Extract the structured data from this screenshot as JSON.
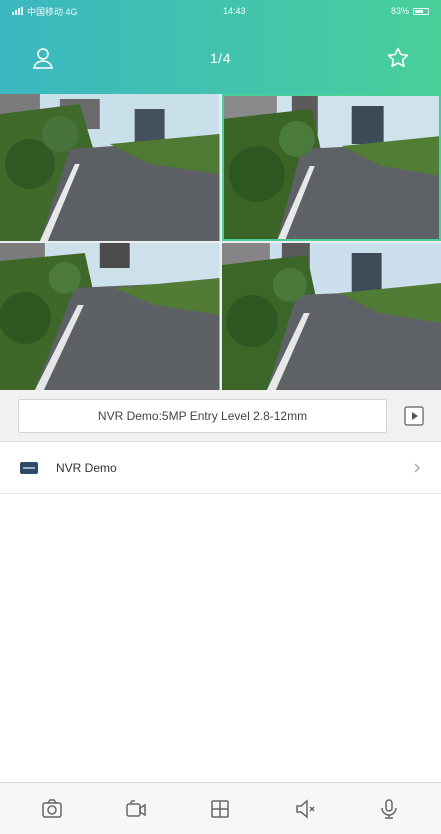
{
  "status_bar": {
    "carrier": "中国移动 4G",
    "time": "14:43",
    "battery": "83%"
  },
  "header": {
    "title": "1/4",
    "left_icon": "user-icon",
    "right_icon": "star-icon"
  },
  "colors": {
    "accent_start": "#3bb7c1",
    "accent_end": "#49cf9a",
    "device_icon": "#2c4a66"
  },
  "video_grid": {
    "channels": [
      {
        "id": "ch1",
        "active": false
      },
      {
        "id": "ch2",
        "active": true
      },
      {
        "id": "ch3",
        "active": false
      },
      {
        "id": "ch4",
        "active": false
      }
    ]
  },
  "camera_name": "NVR Demo:5MP Entry Level 2.8-12mm",
  "devices": [
    {
      "name": "NVR Demo"
    }
  ],
  "toolbar": {
    "items": [
      "camera-icon",
      "record-icon",
      "grid-icon",
      "mute-icon",
      "mic-icon"
    ]
  }
}
